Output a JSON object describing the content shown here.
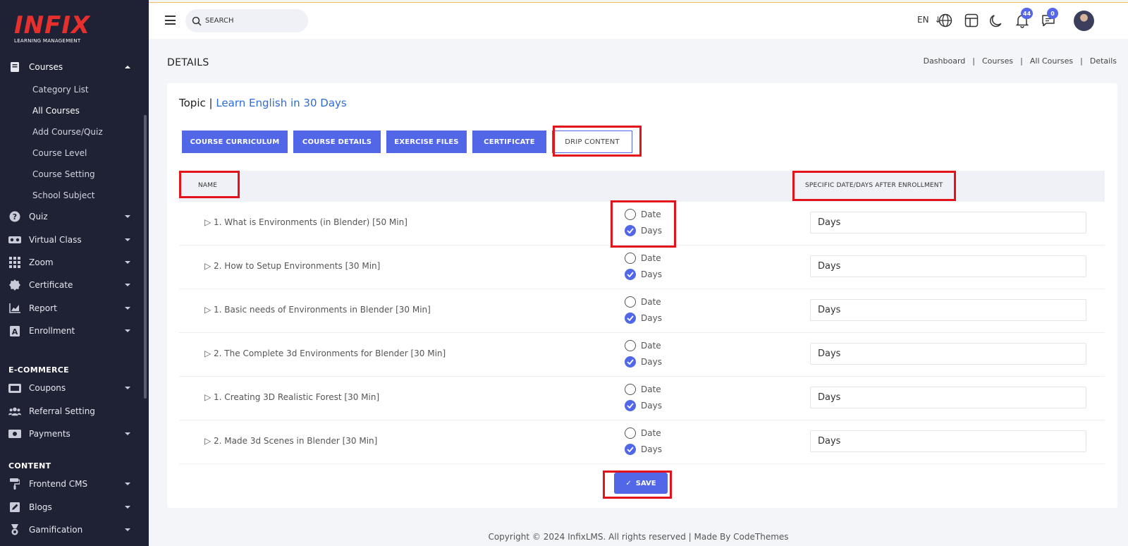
{
  "brand": {
    "logo_text": "INFIX",
    "logo_sub": "LEARNING MANAGEMENT",
    "accent": "#e5302e"
  },
  "sidebar": {
    "courses": {
      "label": "Courses",
      "icon": "book-icon"
    },
    "sub_items": [
      "Category List",
      "All Courses",
      "Add Course/Quiz",
      "Course Level",
      "Course Setting",
      "School Subject"
    ],
    "items": [
      {
        "label": "Quiz",
        "icon": "question-icon"
      },
      {
        "label": "Virtual Class",
        "icon": "vr-icon"
      },
      {
        "label": "Zoom",
        "icon": "grid-icon"
      },
      {
        "label": "Certificate",
        "icon": "certificate-icon"
      },
      {
        "label": "Report",
        "icon": "chart-icon"
      },
      {
        "label": "Enrollment",
        "icon": "enrollment-icon"
      }
    ],
    "ecommerce_head": "E-COMMERCE",
    "ecommerce_items": [
      {
        "label": "Coupons",
        "icon": "ticket-icon"
      },
      {
        "label": "Referral Setting",
        "icon": "users-icon"
      },
      {
        "label": "Payments",
        "icon": "money-icon"
      }
    ],
    "content_head": "CONTENT",
    "content_items": [
      {
        "label": "Frontend CMS",
        "icon": "paint-roller-icon"
      },
      {
        "label": "Blogs",
        "icon": "edit-icon"
      },
      {
        "label": "Gamification",
        "icon": "medal-icon"
      }
    ]
  },
  "header": {
    "search_placeholder": "SEARCH",
    "lang": "EN",
    "notifications_count": "44",
    "messages_count": "0"
  },
  "page": {
    "title": "DETAILS",
    "breadcrumb": [
      "Dashboard",
      "Courses",
      "All Courses",
      "Details"
    ]
  },
  "card": {
    "topic_label": "Topic |",
    "topic_name": "Learn English in 30 Days",
    "tabs": [
      "COURSE CURRICULUM",
      "COURSE DETAILS",
      "EXERCISE FILES",
      "CERTIFICATE",
      "DRIP CONTENT"
    ],
    "col_name": "NAME",
    "col_date": "SPECIFIC DATE/DAYS AFTER ENROLLMENT",
    "date_label": "Date",
    "days_label": "Days",
    "rows": [
      {
        "name": "1. What is Environments (in Blender) [50 Min]",
        "value": "Days"
      },
      {
        "name": "2. How to Setup Environments [30 Min]",
        "value": "Days"
      },
      {
        "name": "1. Basic needs of Environments in Blender [30 Min]",
        "value": "Days"
      },
      {
        "name": "2. The Complete 3d Environments for Blender [30 Min]",
        "value": "Days"
      },
      {
        "name": "1. Creating 3D Realistic Forest [30 Min]",
        "value": "Days"
      },
      {
        "name": "2. Made 3d Scenes in Blender [30 Min]",
        "value": "Days"
      }
    ],
    "save_label": "SAVE"
  },
  "footer": {
    "text": "Copyright © 2024 InfixLMS. All rights reserved | Made By CodeThemes"
  },
  "colors": {
    "primary": "#5266e8",
    "highlight": "#e3131b",
    "sidebar_bg": "#1e2234"
  }
}
